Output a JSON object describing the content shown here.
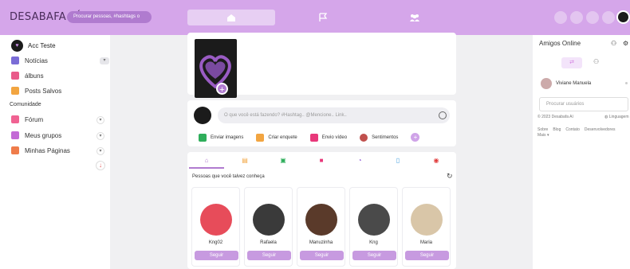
{
  "brand": "DESABAFA AÍ",
  "search": {
    "placeholder": "Procurar pessoas, #hashtags o"
  },
  "colors": {
    "topbar": "#d5a6ea",
    "accent": "#b07bcf",
    "follow": "#c79ae0"
  },
  "left_sidebar": {
    "username": "Acc Teste",
    "items": [
      {
        "label": "Notícias",
        "icon": "news-icon"
      },
      {
        "label": "álbuns",
        "icon": "album-icon"
      },
      {
        "label": "Posts Salvos",
        "icon": "bookmark-icon"
      }
    ],
    "section": "Comunidade",
    "community_items": [
      {
        "label": "Fórum",
        "icon": "forum-icon"
      },
      {
        "label": "Meus grupos",
        "icon": "groups-icon"
      },
      {
        "label": "Minhas Páginas",
        "icon": "flag-icon"
      }
    ]
  },
  "composer": {
    "placeholder": "O que você está fazendo? #Hashtag.. @Mencione.. Link..",
    "actions": [
      "Enviar imagens",
      "Criar enquete",
      "Envio vídeo",
      "Sentimentos"
    ]
  },
  "suggestions": {
    "title": "Pessoas que você talvez conheça",
    "follow_label": "Seguir",
    "people": [
      {
        "name": "Kng02"
      },
      {
        "name": "Rafaela"
      },
      {
        "name": "Manuzinha"
      },
      {
        "name": "Kng"
      },
      {
        "name": "Maria"
      }
    ]
  },
  "right_sidebar": {
    "title": "Amigos Online",
    "friend": "Viviane Manuela",
    "search_placeholder": "Procurar usuários",
    "copyright": "© 2023 Desabafa Aí",
    "language": "Linguagem",
    "links": [
      "Sobre",
      "Blog",
      "Contato",
      "Desenvolvedores"
    ],
    "more": "Mais"
  }
}
